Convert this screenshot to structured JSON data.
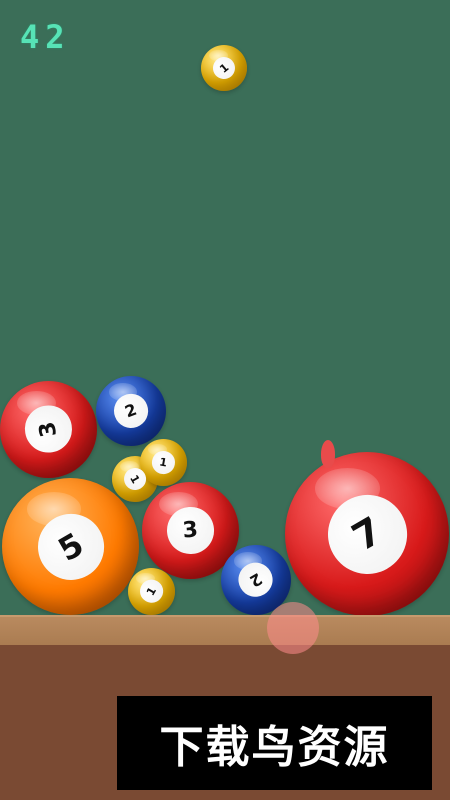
{
  "hud": {
    "score": "42"
  },
  "balls": {
    "falling_1": {
      "color": "yellow",
      "number": "1"
    },
    "red_3_left": {
      "color": "red",
      "number": "3"
    },
    "blue_2_top": {
      "color": "blue",
      "number": "2"
    },
    "yellow_1_a": {
      "color": "yellow",
      "number": "1"
    },
    "yellow_1_b": {
      "color": "yellow",
      "number": "1"
    },
    "orange_5": {
      "color": "orange",
      "number": "5"
    },
    "red_3_mid": {
      "color": "red",
      "number": "3"
    },
    "yellow_1_low": {
      "color": "yellow",
      "number": "1"
    },
    "blue_2_low": {
      "color": "blue",
      "number": "2"
    },
    "red_7": {
      "color": "red",
      "number": "7"
    }
  },
  "watermark": {
    "text": "下载鸟资源"
  }
}
